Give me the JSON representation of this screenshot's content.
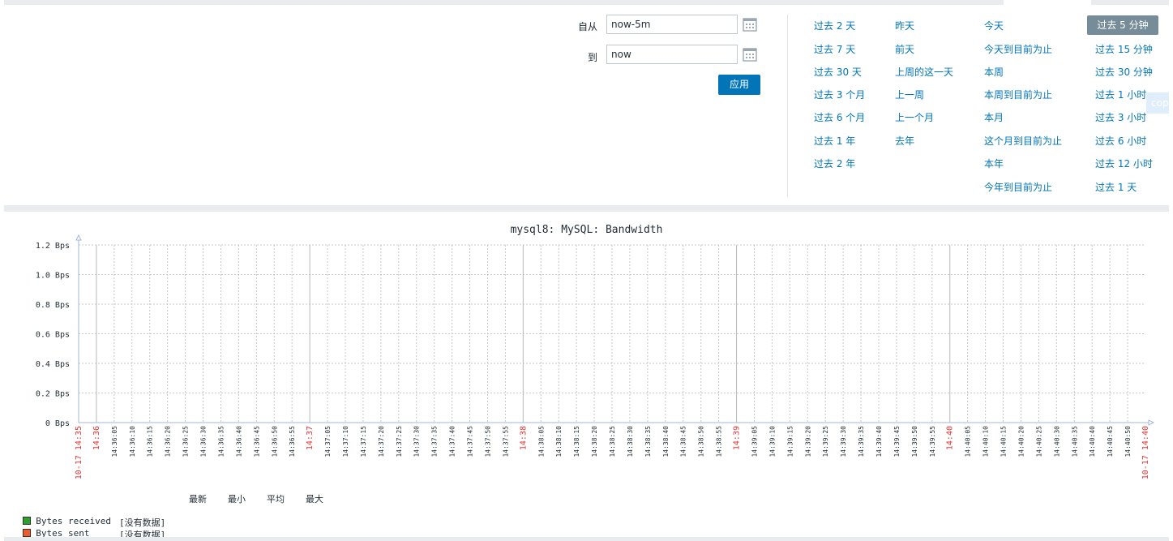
{
  "filter": {
    "from_label": "自从",
    "from_value": "now-5m",
    "to_label": "到",
    "to_value": "now",
    "apply_label": "应用"
  },
  "quick_ranges": {
    "col1": [
      "过去 2 天",
      "过去 7 天",
      "过去 30 天",
      "过去 3 个月",
      "过去 6 个月",
      "过去 1 年",
      "过去 2 年"
    ],
    "col2": [
      "昨天",
      "前天",
      "上周的这一天",
      "上一周",
      "上一个月",
      "去年"
    ],
    "col3": [
      "今天",
      "今天到目前为止",
      "本周",
      "本周到目前为止",
      "本月",
      "这个月到目前为止",
      "本年",
      "今年到目前为止"
    ],
    "col4": [
      "过去 5 分钟",
      "过去 15 分钟",
      "过去 30 分钟",
      "过去 1 小时",
      "过去 3 小时",
      "过去 6 小时",
      "过去 12 小时",
      "过去 1 天"
    ],
    "selected": "过去 5 分钟"
  },
  "copy_tab": "cop",
  "chart_data": {
    "type": "line",
    "title": "mysql8: MySQL: Bandwidth",
    "y_ticks": [
      "0 Bps",
      "0.2 Bps",
      "0.4 Bps",
      "0.6 Bps",
      "0.8 Bps",
      "1.0 Bps",
      "1.2 Bps"
    ],
    "ylim": [
      0,
      1.2
    ],
    "y_unit": "Bps",
    "x_start_label": "10-17 14:35",
    "x_end_label": "10-17 14:40",
    "x_major_labels": [
      "14:36",
      "14:37",
      "14:38",
      "14:39",
      "14:40"
    ],
    "x_minor_labels": [
      "14:36:05",
      "14:36:10",
      "14:36:15",
      "14:36:20",
      "14:36:25",
      "14:36:30",
      "14:36:35",
      "14:36:40",
      "14:36:45",
      "14:36:50",
      "14:36:55",
      "14:37:05",
      "14:37:10",
      "14:37:15",
      "14:37:20",
      "14:37:25",
      "14:37:30",
      "14:37:35",
      "14:37:40",
      "14:37:45",
      "14:37:50",
      "14:37:55",
      "14:38:05",
      "14:38:10",
      "14:38:15",
      "14:38:20",
      "14:38:25",
      "14:38:30",
      "14:38:35",
      "14:38:40",
      "14:38:45",
      "14:38:50",
      "14:38:55",
      "14:39:05",
      "14:39:10",
      "14:39:15",
      "14:39:20",
      "14:39:25",
      "14:39:30",
      "14:39:35",
      "14:39:40",
      "14:39:45",
      "14:39:50",
      "14:39:55",
      "14:40:05",
      "14:40:10",
      "14:40:15",
      "14:40:20",
      "14:40:25",
      "14:40:30",
      "14:40:35",
      "14:40:40",
      "14:40:45",
      "14:40:50"
    ],
    "grid": true,
    "legend_position": "bottom-left",
    "legend_headers": [
      "最新",
      "最小",
      "平均",
      "最大"
    ],
    "series": [
      {
        "name": "Bytes received",
        "color": "#2ca02c",
        "status": "[没有数据]",
        "values": []
      },
      {
        "name": "Bytes sent",
        "color": "#f05a28",
        "status": "[没有数据]",
        "values": []
      }
    ],
    "accent_color": "#e33734",
    "axis_color": "#a3b7d9"
  }
}
